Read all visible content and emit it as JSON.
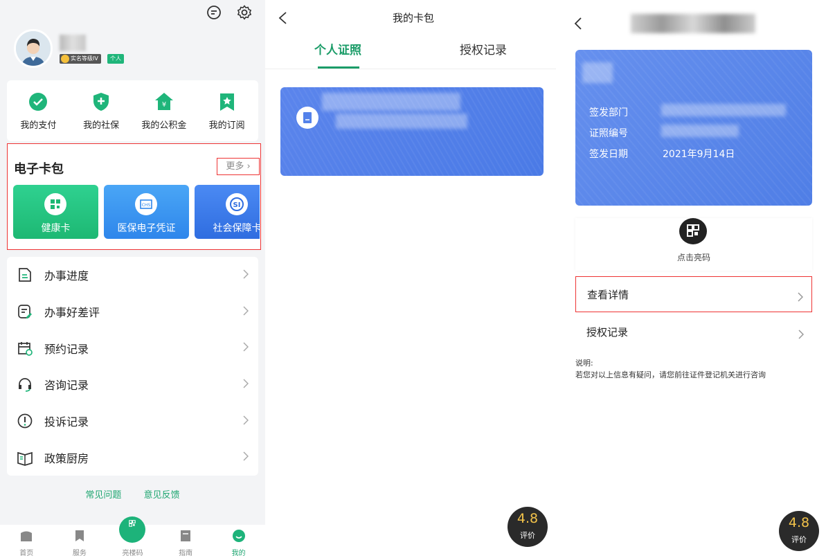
{
  "panel1": {
    "badges": {
      "level": "实名等级IV",
      "person": "个人"
    },
    "shortcuts": [
      {
        "label": "我的支付",
        "icon": "check-circle-icon"
      },
      {
        "label": "我的社保",
        "icon": "shield-plus-icon"
      },
      {
        "label": "我的公积金",
        "icon": "house-yen-icon"
      },
      {
        "label": "我的订阅",
        "icon": "bookmark-star-icon"
      }
    ],
    "ecard": {
      "title": "电子卡包",
      "more": "更多",
      "cards": [
        {
          "label": "健康卡",
          "icon": "health-card-icon"
        },
        {
          "label": "医保电子凭证",
          "icon": "chs-icon"
        },
        {
          "label": "社会保障卡",
          "icon": "si-icon"
        }
      ]
    },
    "menu": [
      {
        "label": "办事进度",
        "icon": "progress-doc-icon"
      },
      {
        "label": "办事好差评",
        "icon": "review-icon"
      },
      {
        "label": "预约记录",
        "icon": "calendar-clock-icon"
      },
      {
        "label": "咨询记录",
        "icon": "headset-icon"
      },
      {
        "label": "投诉记录",
        "icon": "alert-circle-icon"
      },
      {
        "label": "政策厨房",
        "icon": "book-icon"
      }
    ],
    "links": {
      "faq": "常见问题",
      "feedback": "意见反馈"
    },
    "tabbar": [
      {
        "label": "首页"
      },
      {
        "label": "服务"
      },
      {
        "label": "亮楼码"
      },
      {
        "label": "指南"
      },
      {
        "label": "我的"
      }
    ],
    "accent": "#1fa671"
  },
  "panel2": {
    "title": "我的卡包",
    "tabs": [
      "个人证照",
      "授权记录"
    ],
    "score": {
      "value": "4.8",
      "label": "评价"
    },
    "accent": "#1b9c68",
    "card_color": "#5482ea"
  },
  "panel3": {
    "fields": [
      {
        "key": "签发部门",
        "value": ""
      },
      {
        "key": "证照编号",
        "value": ""
      },
      {
        "key": "签发日期",
        "value": "2021年9月14日"
      }
    ],
    "qr_label": "点击亮码",
    "rows": {
      "detail": "查看详情",
      "auth": "授权记录"
    },
    "note_title": "说明:",
    "note_text": "若您对以上信息有疑问，请您前往证件登记机关进行咨询",
    "score": {
      "value": "4.8",
      "label": "评价"
    },
    "highlight_color": "#ee3333"
  }
}
